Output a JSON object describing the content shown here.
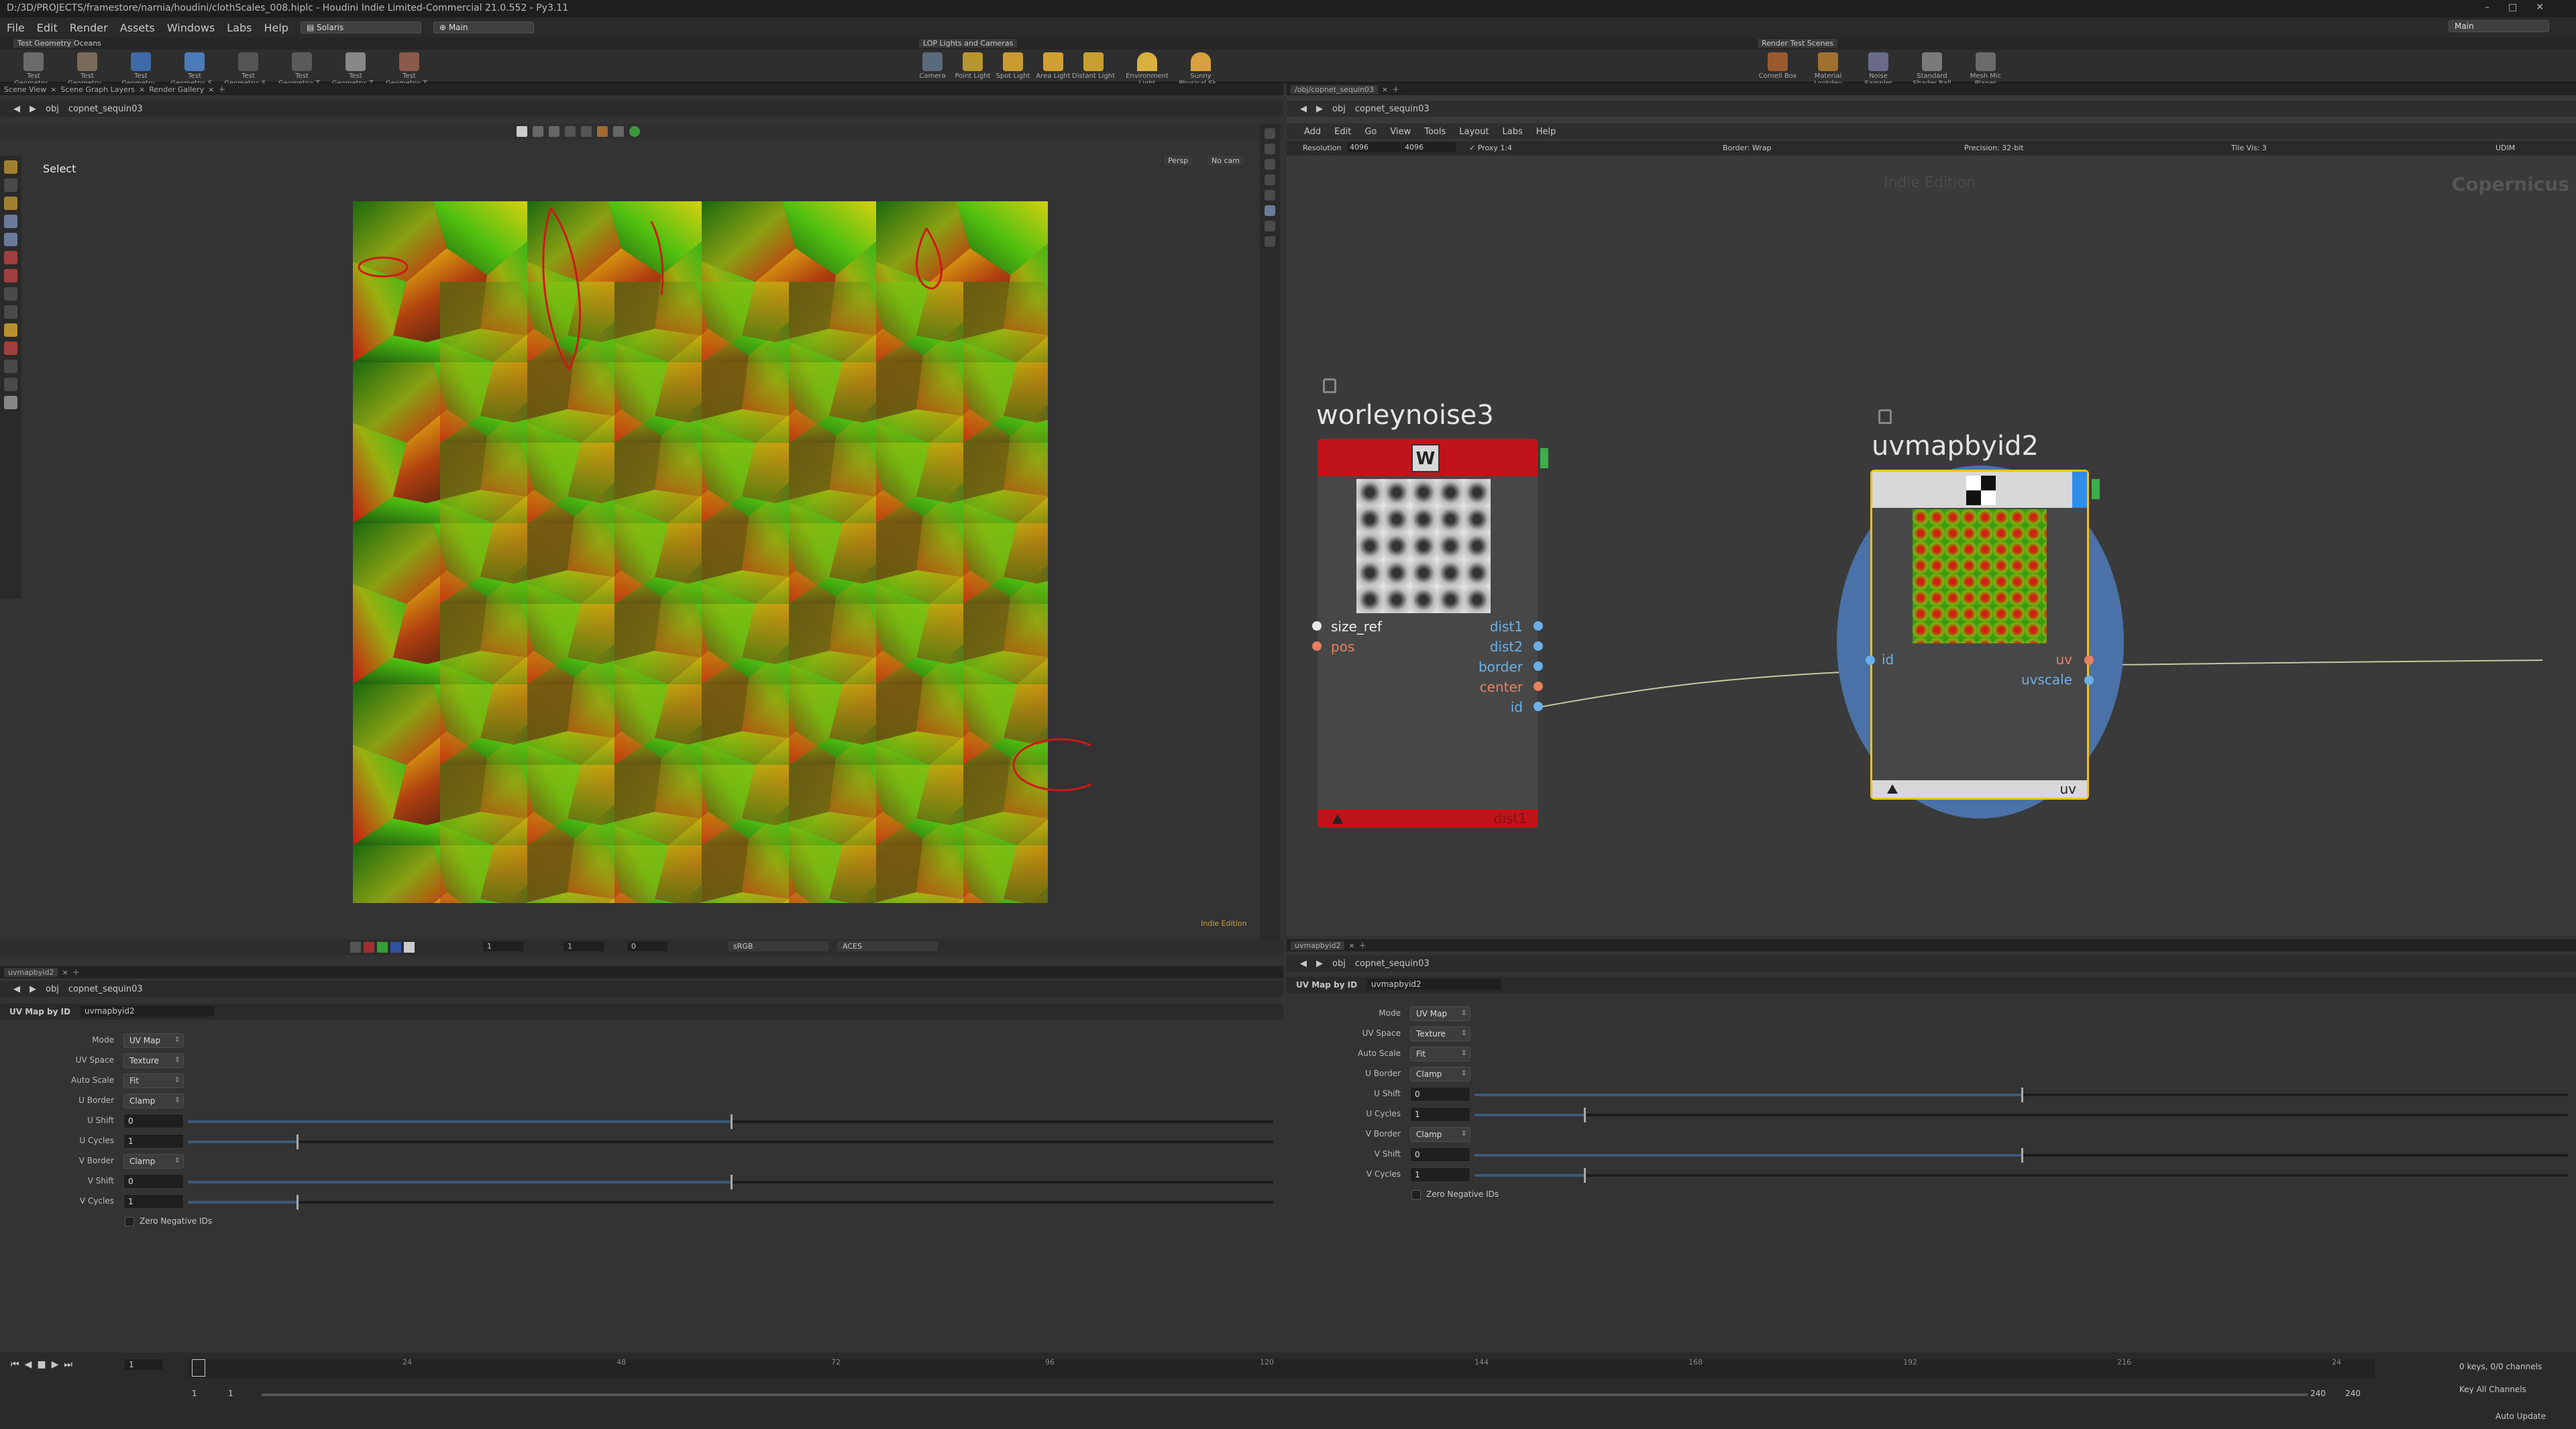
{
  "titlebar": {
    "title": "D:/3D/PROJECTS/framestore/narnia/houdini/clothScales_008.hiplc - Houdini Indie Limited-Commercial 21.0.552 - Py3.11"
  },
  "menu": {
    "items": [
      "File",
      "Edit",
      "Render",
      "Assets",
      "Windows",
      "Labs",
      "Help"
    ],
    "desktop": "Solaris",
    "desktop2": "Main",
    "right": "Main"
  },
  "shelf": {
    "tabs": [
      "Test Geometry",
      "Oceans"
    ],
    "left_tools": [
      "Test Geometry...",
      "Test Geometry...",
      "Test Geometry...",
      "Test Geometry: S...",
      "Test Geometry: S...",
      "Test Geometry: T...",
      "Test Geometry: T...",
      "Test Geometry: T..."
    ],
    "mid_tab": "LOP Lights and Cameras",
    "mid_tools": [
      "Camera",
      "Point Light",
      "Spot Light",
      "Area Light",
      "Distant Light",
      "Environment Light",
      "Sunny Physical Sk..."
    ],
    "right_tab": "Render Test Scenes",
    "right_tools": [
      "Cornell Box",
      "Material Lookdev",
      "Noise Sampler",
      "Standard Shader Ball",
      "Mesh Mic Planes"
    ]
  },
  "viewer": {
    "tabs": [
      "Scene View",
      "Scene Graph Layers",
      "Render Gallery"
    ],
    "path": [
      "obj",
      "copnet_sequin03"
    ],
    "state": "Select",
    "persp": "Persp",
    "cam": "No cam",
    "edition": "Indie Edition",
    "colorspace": "sRGB",
    "view_transform": "ACES",
    "frame_a": "1",
    "frame_b": "1",
    "frame_c": "0"
  },
  "network": {
    "tab": "/obj/copnet_sequin03",
    "path": [
      "obj",
      "copnet_sequin03"
    ],
    "menu": [
      "Add",
      "Edit",
      "Go",
      "View",
      "Tools",
      "Layout",
      "Labs",
      "Help"
    ],
    "info": {
      "resolution_label": "Resolution",
      "res_x": "4096",
      "res_y": "4096",
      "proxy": "Proxy 1:4",
      "border": "Border: Wrap",
      "precision": "Precision: 32-bit",
      "tile": "Tile Vis: 3",
      "udim": "UDIM"
    },
    "watermark": "Indie Edition",
    "context": "Copernicus",
    "node1": {
      "name": "worleynoise3",
      "letter": "W",
      "inputs": [
        "size_ref",
        "pos"
      ],
      "outputs": [
        "dist1",
        "dist2",
        "border",
        "center",
        "id"
      ],
      "footer": "dist1"
    },
    "node2": {
      "name": "uvmapbyid2",
      "inputs": [
        "id"
      ],
      "outputs": [
        "uv",
        "uvscale"
      ],
      "footer": "uv"
    }
  },
  "parms_left": {
    "tab": "uvmapbyid2",
    "path": [
      "obj",
      "copnet_sequin03"
    ],
    "node_type": "UV Map by ID",
    "node_name": "uvmapbyid2",
    "rows": [
      {
        "label": "Mode",
        "kind": "menu",
        "value": "UV Map"
      },
      {
        "label": "UV Space",
        "kind": "menu",
        "value": "Texture"
      },
      {
        "label": "Auto Scale",
        "kind": "menu",
        "value": "Fit"
      },
      {
        "label": "U Border",
        "kind": "menu",
        "value": "Clamp"
      },
      {
        "label": "U Shift",
        "kind": "slider",
        "value": "0",
        "level": 0.5
      },
      {
        "label": "U Cycles",
        "kind": "slider",
        "value": "1",
        "level": 0.1
      },
      {
        "label": "V Border",
        "kind": "menu",
        "value": "Clamp"
      },
      {
        "label": "V Shift",
        "kind": "slider",
        "value": "0",
        "level": 0.5
      },
      {
        "label": "V Cycles",
        "kind": "slider",
        "value": "1",
        "level": 0.1
      }
    ],
    "checkbox": "Zero Negative IDs"
  },
  "parms_right": {
    "tab": "uvmapbyid2",
    "path": [
      "obj",
      "copnet_sequin03"
    ],
    "node_type": "UV Map by ID",
    "node_name": "uvmapbyid2",
    "rows": [
      {
        "label": "Mode",
        "kind": "menu",
        "value": "UV Map"
      },
      {
        "label": "UV Space",
        "kind": "menu",
        "value": "Texture"
      },
      {
        "label": "Auto Scale",
        "kind": "menu",
        "value": "Fit"
      },
      {
        "label": "U Border",
        "kind": "menu",
        "value": "Clamp"
      },
      {
        "label": "U Shift",
        "kind": "slider",
        "value": "0",
        "level": 0.5
      },
      {
        "label": "U Cycles",
        "kind": "slider",
        "value": "1",
        "level": 0.1
      },
      {
        "label": "V Border",
        "kind": "menu",
        "value": "Clamp"
      },
      {
        "label": "V Shift",
        "kind": "slider",
        "value": "0",
        "level": 0.5
      },
      {
        "label": "V Cycles",
        "kind": "slider",
        "value": "1",
        "level": 0.1
      }
    ],
    "checkbox": "Zero Negative IDs"
  },
  "timeline": {
    "frame": "1",
    "ticks": [
      "24",
      "48",
      "72",
      "96",
      "120",
      "144",
      "168",
      "192",
      "216",
      "24"
    ],
    "start": "1",
    "start2": "1",
    "end": "240",
    "end2": "240",
    "keys": "0 keys, 0/0 channels",
    "key_all": "Key All Channels",
    "auto_update": "Auto Update"
  }
}
